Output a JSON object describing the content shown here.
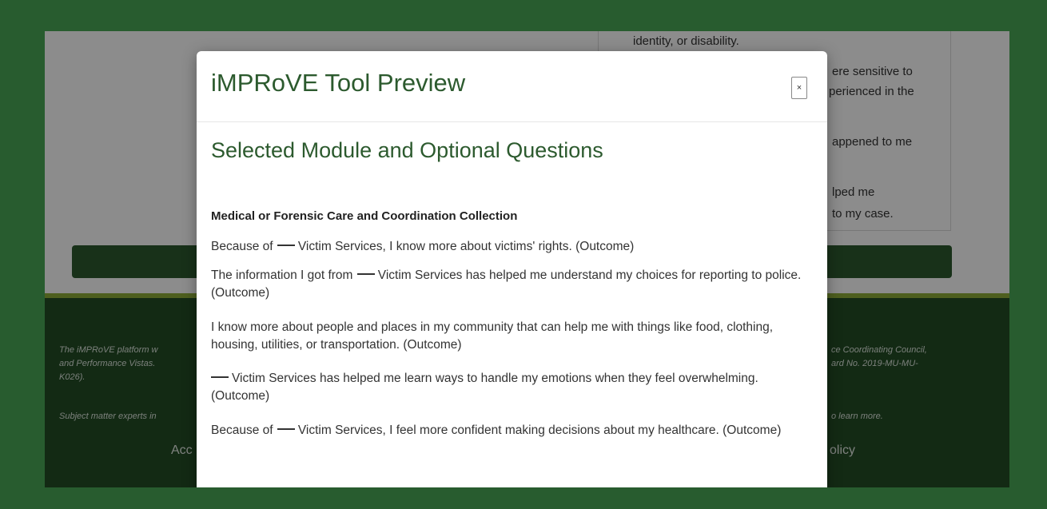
{
  "background": {
    "card_lines": [
      "identity, or disability.",
      "ere sensitive to",
      "perienced in the",
      "appened to me",
      "lped me",
      "to my case."
    ],
    "footer_lines": [
      "The iMPRoVE platform w",
      "and Performance Vistas.",
      "K026).",
      "Subject matter experts in"
    ],
    "footer_right_lines": [
      "ce Coordinating Council,",
      "ard No. 2019-MU-MU-",
      "o learn more."
    ],
    "footer_link_left": "Acc",
    "footer_link_right": "olicy"
  },
  "modal": {
    "title": "iMPRoVE Tool Preview",
    "close_label": "×",
    "section_title": "Selected Module and Optional Questions",
    "module_name": "Medical or Forensic Care and Coordination Collection",
    "questions": [
      {
        "before": "Because of",
        "after": "Victim Services, I know more about victims' rights. (Outcome)"
      },
      {
        "before": "The information I got from",
        "after": "Victim Services has helped me understand my choices for reporting to police. (Outcome)"
      },
      {
        "before": "",
        "after": "I know more about people and places in my community that can help me with things like food, clothing, housing, utilities, or transportation. (Outcome)"
      },
      {
        "before": "",
        "after": "Victim Services has helped me learn ways to handle my emotions when they feel overwhelming. (Outcome)"
      },
      {
        "before": "Because of",
        "after": "Victim Services, I feel more confident making decisions about my healthcare. (Outcome)"
      }
    ]
  },
  "colors": {
    "brand_green": "#2c5a2e",
    "frame_green": "#285c2f",
    "accent_stripe": "#8fae3a"
  }
}
